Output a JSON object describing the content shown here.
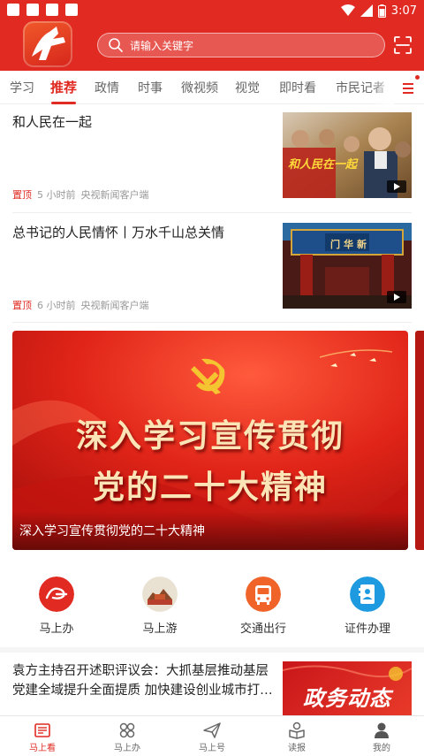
{
  "status_bar": {
    "time": "3:07"
  },
  "header": {
    "search_placeholder": "请输入关键字",
    "icons": {
      "logo": "app-logo",
      "search": "search-icon",
      "scan": "scan-icon"
    },
    "bg_color": "#e02a22"
  },
  "tabs": {
    "items": [
      "学习",
      "推荐",
      "政情",
      "时事",
      "微视频",
      "视觉",
      "即时看",
      "市民记者"
    ],
    "active_index": 1,
    "active_color": "#e02a22"
  },
  "news": [
    {
      "title": "和人民在一起",
      "pin": "置顶",
      "time": "5 小时前",
      "source": "央视新闻客户端",
      "image_text": "和人民在一起"
    },
    {
      "title": "总书记的人民情怀丨万水千山总关情",
      "pin": "置顶",
      "time": "6 小时前",
      "source": "央视新闻客户端",
      "image_text": "门华新"
    }
  ],
  "banner": {
    "line1": "深入学习宣传贯彻",
    "line2": "党的二十大精神",
    "caption": "深入学习宣传贯彻党的二十大精神"
  },
  "quick": [
    {
      "label": "马上办",
      "icon": "mashangban-icon",
      "color": "#e02a22"
    },
    {
      "label": "马上游",
      "icon": "travel-icon",
      "color": "#c0a070"
    },
    {
      "label": "交通出行",
      "icon": "bus-icon",
      "color": "#f0642a"
    },
    {
      "label": "证件办理",
      "icon": "id-card-icon",
      "color": "#1e9be0"
    }
  ],
  "bottom_news": {
    "title": "袁方主持召开述职评议会：大抓基层推动基层党建全域提升全面提质 加快建设创业城市打…",
    "thumb_text": "政务动态"
  },
  "bottom_nav": [
    {
      "label": "马上看",
      "icon": "newspaper-icon",
      "active": true
    },
    {
      "label": "马上办",
      "icon": "apps-icon",
      "active": false
    },
    {
      "label": "马上号",
      "icon": "paper-plane-icon",
      "active": false
    },
    {
      "label": "读报",
      "icon": "reader-icon",
      "active": false
    },
    {
      "label": "我的",
      "icon": "user-icon",
      "active": false
    }
  ]
}
